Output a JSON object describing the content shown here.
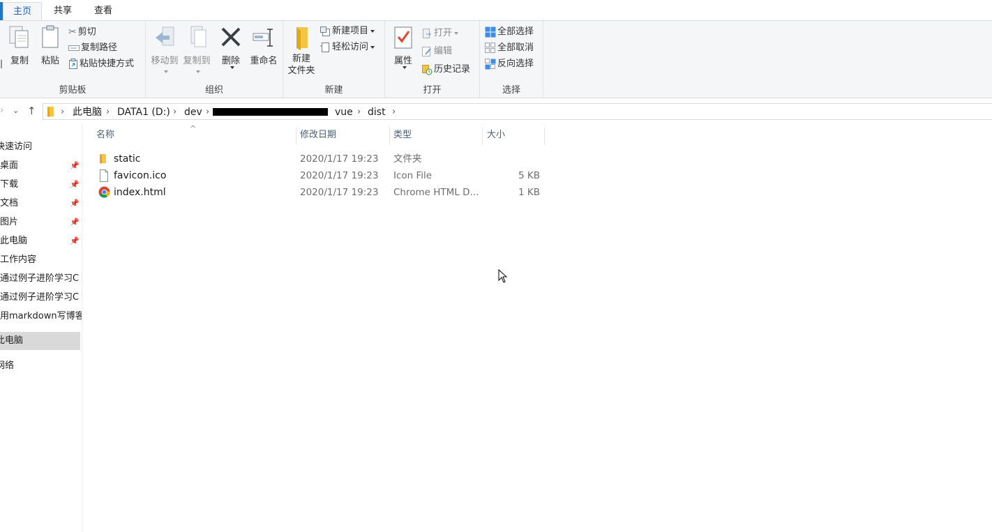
{
  "tabs": [
    {
      "label": "主页",
      "active": true
    },
    {
      "label": "共享",
      "active": false
    },
    {
      "label": "查看",
      "active": false
    }
  ],
  "ribbon": {
    "clipboard": {
      "label": "剪贴板",
      "copy": "复制",
      "paste": "粘贴",
      "cut": "剪切",
      "copy_path": "复制路径",
      "paste_shortcut": "粘贴快捷方式"
    },
    "organize": {
      "label": "组织",
      "move_to": "移动到",
      "copy_to": "复制到",
      "delete": "删除",
      "rename": "重命名"
    },
    "new": {
      "label": "新建",
      "new_folder_line1": "新建",
      "new_folder_line2": "文件夹",
      "new_item": "新建项目",
      "easy_access": "轻松访问"
    },
    "open": {
      "label": "打开",
      "properties": "属性",
      "open": "打开",
      "edit": "编辑",
      "history": "历史记录"
    },
    "select": {
      "label": "选择",
      "select_all": "全部选择",
      "select_none": "全部取消",
      "invert": "反向选择"
    }
  },
  "address": {
    "crumbs": [
      "此电脑",
      "DATA1 (D:)",
      "dev",
      "vue",
      "dist"
    ]
  },
  "sidebar": {
    "items": [
      {
        "label": "快速访问",
        "pinned": false
      },
      {
        "label": "桌面",
        "pinned": true
      },
      {
        "label": "下载",
        "pinned": true
      },
      {
        "label": "文档",
        "pinned": true
      },
      {
        "label": "图片",
        "pinned": true
      },
      {
        "label": "此电脑",
        "pinned": true
      },
      {
        "label": "工作内容",
        "pinned": false
      },
      {
        "label": "通过例子进阶学习C",
        "pinned": false
      },
      {
        "label": "通过例子进阶学习C",
        "pinned": false
      },
      {
        "label": "用markdown写博客",
        "pinned": false
      },
      {
        "label": "此电脑",
        "pinned": false,
        "selected": true
      },
      {
        "label": "网络",
        "pinned": false
      }
    ]
  },
  "columns": {
    "name": "名称",
    "modified": "修改日期",
    "type": "类型",
    "size": "大小"
  },
  "files": [
    {
      "name": "static",
      "modified": "2020/1/17 19:23",
      "type": "文件夹",
      "size": "",
      "icon": "folder-icon"
    },
    {
      "name": "favicon.ico",
      "modified": "2020/1/17 19:23",
      "type": "Icon File",
      "size": "5 KB",
      "icon": "file-icon"
    },
    {
      "name": "index.html",
      "modified": "2020/1/17 19:23",
      "type": "Chrome HTML D...",
      "size": "1 KB",
      "icon": "chrome-icon"
    }
  ],
  "colors": {
    "accent": "#1979ca",
    "header_text": "#4c607a",
    "folder": "#f4c542"
  }
}
